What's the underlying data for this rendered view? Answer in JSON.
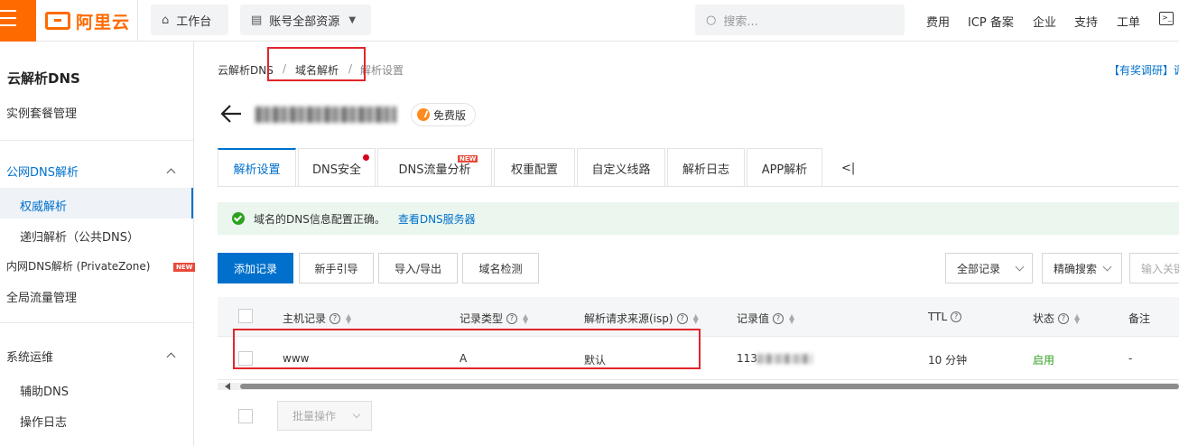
{
  "topbar": {
    "logo_text": "阿里云",
    "workbench": "工作台",
    "resources": "账号全部资源",
    "search_placeholder": "搜索...",
    "nav": [
      "费用",
      "ICP 备案",
      "企业",
      "支持",
      "工单"
    ]
  },
  "sidebar": {
    "title": "云解析DNS",
    "instance": "实例套餐管理",
    "public_dns": "公网DNS解析",
    "authoritative": "权威解析",
    "recursive": "递归解析（公共DNS）",
    "private_zone": "内网DNS解析 (PrivateZone)",
    "new_badge": "NEW",
    "global_traffic": "全局流量管理",
    "ops": "系统运维",
    "aux_dns": "辅助DNS",
    "op_log": "操作日志"
  },
  "breadcrumb": {
    "root": "云解析DNS",
    "domain": "域名解析",
    "current": "解析设置",
    "sep": "/"
  },
  "survey": "【有奖调研】调",
  "header": {
    "plan_tag": "免费版"
  },
  "tabs": [
    {
      "label": "解析设置"
    },
    {
      "label": "DNS安全"
    },
    {
      "label": "DNS流量分析"
    },
    {
      "label": "权重配置"
    },
    {
      "label": "自定义线路"
    },
    {
      "label": "解析日志"
    },
    {
      "label": "APP解析"
    }
  ],
  "tab_new_badge": "NEW",
  "tab_more": "<|",
  "alert": {
    "message": "域名的DNS信息配置正确。",
    "link": "查看DNS服务器"
  },
  "toolbar": {
    "add": "添加记录",
    "guide": "新手引导",
    "import_export": "导入/导出",
    "domain_check": "域名检测",
    "all_records": "全部记录",
    "precise_search": "精确搜索",
    "search_placeholder": "输入关键字"
  },
  "table": {
    "columns": [
      "主机记录",
      "记录类型",
      "解析请求来源(isp)",
      "记录值",
      "TTL",
      "状态",
      "备注"
    ],
    "rows": [
      {
        "host": "www",
        "type": "A",
        "line": "默认",
        "value": "113.",
        "ttl": "10 分钟",
        "status": "启用",
        "remark": "-"
      }
    ]
  },
  "bulk_action": "批量操作",
  "colors": {
    "accent": "#0070cc",
    "brand": "#ff6a00",
    "success": "#2ea121",
    "annotation": "#e1252c"
  }
}
